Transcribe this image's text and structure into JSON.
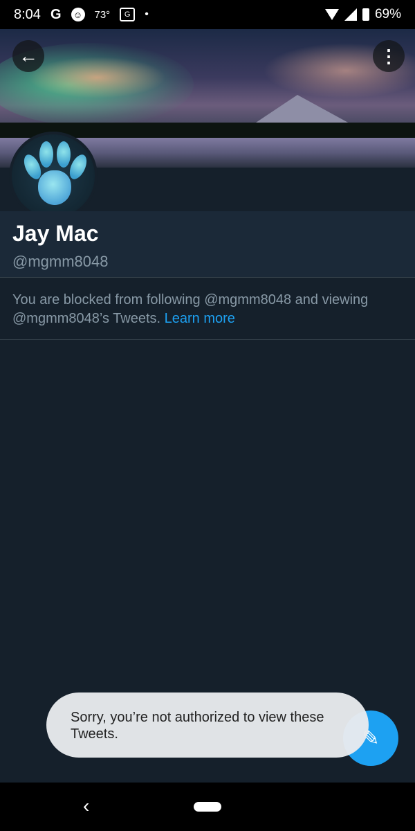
{
  "status_bar": {
    "time": "8:04",
    "google_glyph": "G",
    "temperature": "73°",
    "translate_glyph": "G",
    "notification_dot": "•",
    "battery_percent": "69%",
    "icons": [
      "google-icon",
      "smiley-icon",
      "translate-icon",
      "wifi-icon",
      "signal-icon",
      "battery-icon"
    ]
  },
  "header": {
    "back_glyph": "←",
    "more_glyph": "⋮"
  },
  "profile": {
    "display_name": "Jay Mac",
    "handle": "@mgmm8048"
  },
  "blocked_notice": {
    "text": "You are blocked from following @mgmm8048 and viewing @mgmm8048’s Tweets.",
    "learn_more": "Learn more"
  },
  "toast": {
    "message": "Sorry, you’re not authorized to view these Tweets."
  },
  "fab": {
    "glyph": "✎"
  },
  "nav": {
    "back_glyph": "‹"
  },
  "colors": {
    "background": "#15202b",
    "accent": "#1da1f2",
    "secondary_text": "#8899a6"
  }
}
